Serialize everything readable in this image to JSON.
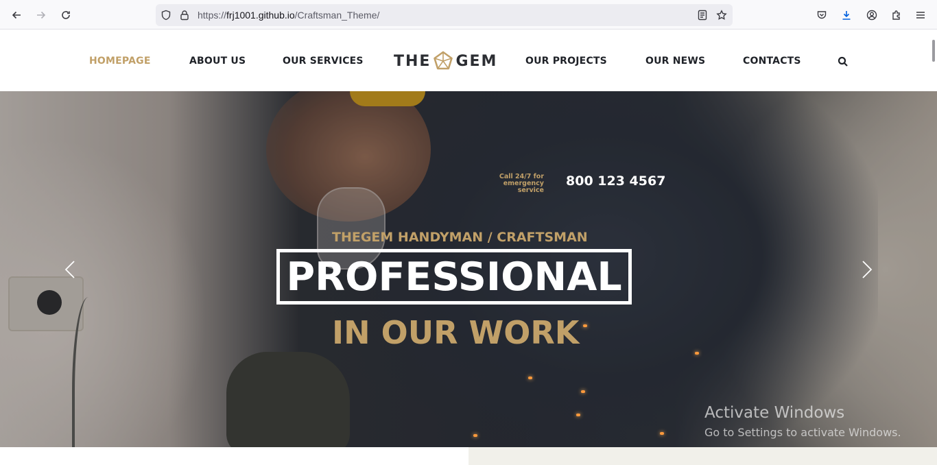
{
  "browser": {
    "url_prefix": "https://",
    "url_host": "frj1001.github.io",
    "url_path": "/Craftsman_Theme/",
    "icons": [
      "back-arrow-icon",
      "forward-arrow-icon",
      "reload-icon",
      "shield-icon",
      "lock-icon",
      "reader-view-icon",
      "bookmark-star-icon",
      "pocket-icon",
      "download-icon",
      "account-icon",
      "extensions-icon",
      "hamburger-menu-icon"
    ]
  },
  "nav": {
    "left": [
      {
        "label": "HOMEPAGE",
        "active": true
      },
      {
        "label": "ABOUT US"
      },
      {
        "label": "OUR SERVICES"
      }
    ],
    "right": [
      {
        "label": "OUR PROJECTS"
      },
      {
        "label": "OUR NEWS"
      },
      {
        "label": "CONTACTS"
      }
    ],
    "logo_left": "THE",
    "logo_right": "GEM",
    "search_icon": "search-icon"
  },
  "hero": {
    "call_label_line1": "Call 24/7 for",
    "call_label_line2": "emergency service",
    "phone": "800 123 4567",
    "subtitle": "THEGEM HANDYMAN / CRAFTSMAN",
    "headline": "PROFESSIONAL",
    "headline2": "IN OUR WORK",
    "prev_icon": "chevron-left-icon",
    "next_icon": "chevron-right-icon"
  },
  "watermark": {
    "line1": "Activate Windows",
    "line2": "Go to Settings to activate Windows."
  },
  "colors": {
    "accent": "#c1a068",
    "text_dark": "#1f2228",
    "hero_text": "#ffffff"
  }
}
